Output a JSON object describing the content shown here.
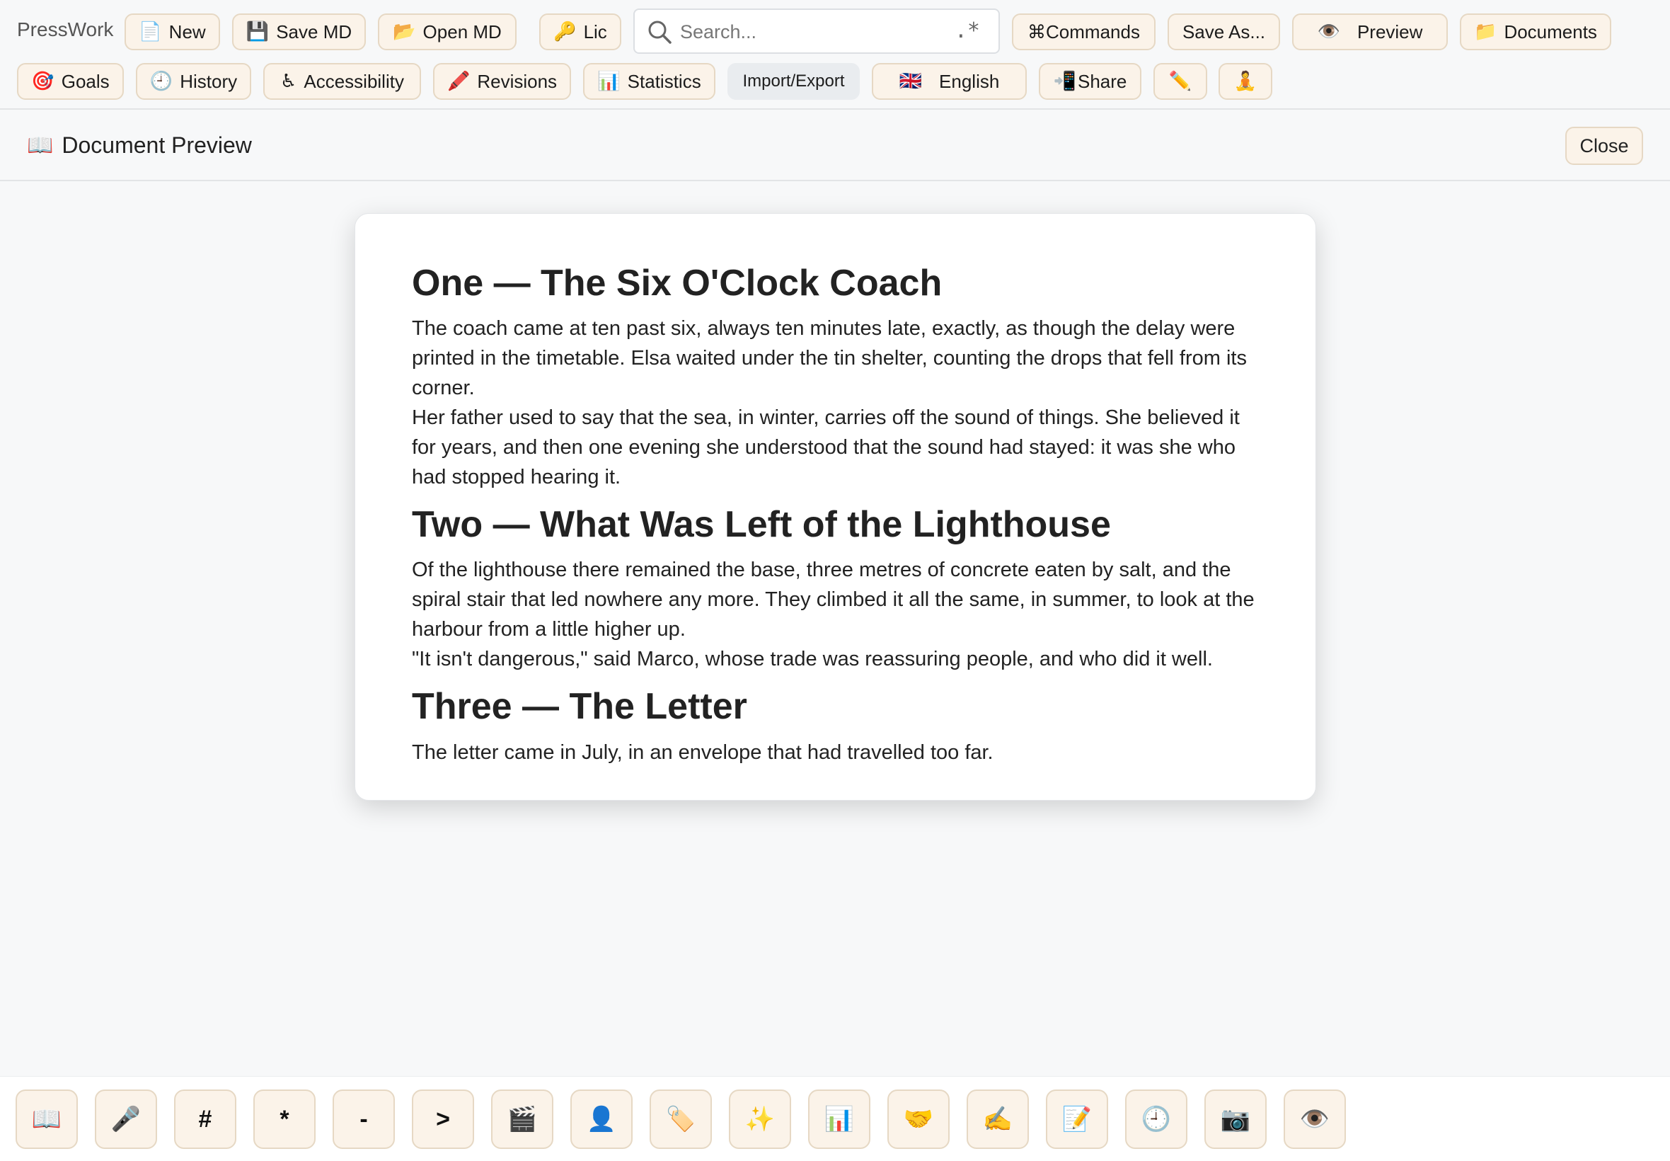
{
  "app": {
    "name": "PressWork"
  },
  "toolbar": {
    "row1": [
      {
        "id": "new",
        "icon": "📄",
        "icon_name": "page-icon",
        "label": "New"
      },
      {
        "id": "save-md",
        "icon": "💾",
        "icon_name": "floppy-disk-icon",
        "label": "Save MD"
      },
      {
        "id": "open-md",
        "icon": "📂",
        "icon_name": "open-folder-icon",
        "label": "Open MD"
      },
      {
        "id": "lic",
        "icon": "🔑",
        "icon_name": "key-icon",
        "label": "Lic"
      },
      {
        "id": "commands",
        "icon": "",
        "icon_name": "",
        "label": "⌘Commands"
      },
      {
        "id": "save-as",
        "icon": "",
        "icon_name": "",
        "label": "Save As..."
      },
      {
        "id": "preview",
        "icon": "👁️",
        "icon_name": "eye-icon",
        "label": "Preview"
      },
      {
        "id": "documents",
        "icon": "📁",
        "icon_name": "folder-icon",
        "label": "Documents"
      }
    ],
    "row2": [
      {
        "id": "goals",
        "icon": "🎯",
        "icon_name": "target-icon",
        "label": "Goals"
      },
      {
        "id": "history",
        "icon": "🕘",
        "icon_name": "clock-icon",
        "label": "History"
      },
      {
        "id": "accessibility",
        "icon": "♿",
        "icon_name": "wheelchair-icon",
        "label": "Accessibility"
      },
      {
        "id": "revisions",
        "icon": "🖍️",
        "icon_name": "crayon-icon",
        "label": "Revisions"
      },
      {
        "id": "statistics",
        "icon": "📊",
        "icon_name": "bar-chart-icon",
        "label": "Statistics"
      },
      {
        "id": "import-export",
        "icon": "",
        "icon_name": "",
        "label": "Import/Export"
      },
      {
        "id": "language",
        "icon": "🇬🇧",
        "icon_name": "uk-flag-icon",
        "label": "English"
      },
      {
        "id": "share",
        "icon": "📲",
        "icon_name": "phone-arrow-icon",
        "label": "Share"
      },
      {
        "id": "pencil",
        "icon": "✏️",
        "icon_name": "pencil-icon",
        "label": ""
      },
      {
        "id": "focus",
        "icon": "🧘",
        "icon_name": "meditation-icon",
        "label": ""
      }
    ],
    "search": {
      "placeholder": "Search...",
      "regex_label": ".*"
    }
  },
  "preview": {
    "title_icon": "📖",
    "title": "Document Preview",
    "close_label": "Close"
  },
  "document": {
    "sections": [
      {
        "heading": "One — The Six O'Clock Coach",
        "paragraphs": [
          "The coach came at ten past six, always ten minutes late, exactly, as though the delay were printed in the timetable. Elsa waited under the tin shelter, counting the drops that fell from its corner.",
          "Her father used to say that the sea, in winter, carries off the sound of things. She believed it for years, and then one evening she understood that the sound had stayed: it was she who had stopped hearing it."
        ]
      },
      {
        "heading": "Two — What Was Left of the Lighthouse",
        "paragraphs": [
          "Of the lighthouse there remained the base, three metres of concrete eaten by salt, and the spiral stair that led nowhere any more. They climbed it all the same, in summer, to look at the harbour from a little higher up.",
          "\"It isn't dangerous,\" said Marco, whose trade was reassuring people, and who did it well."
        ]
      },
      {
        "heading": "Three — The Letter",
        "paragraphs": [
          "The letter came in July, in an envelope that had travelled too far."
        ]
      }
    ]
  },
  "bottom_bar": [
    {
      "glyph": "📖",
      "name": "book-icon"
    },
    {
      "glyph": "🎤",
      "name": "microphone-icon"
    },
    {
      "glyph": "#",
      "name": "heading-button"
    },
    {
      "glyph": "*",
      "name": "emphasis-button"
    },
    {
      "glyph": "-",
      "name": "list-button"
    },
    {
      "glyph": ">",
      "name": "quote-button"
    },
    {
      "glyph": "🎬",
      "name": "clapperboard-icon"
    },
    {
      "glyph": "👤",
      "name": "person-icon"
    },
    {
      "glyph": "🏷️",
      "name": "tag-icon"
    },
    {
      "glyph": "✨",
      "name": "sparkles-icon"
    },
    {
      "glyph": "📊",
      "name": "bar-chart-icon"
    },
    {
      "glyph": "🤝",
      "name": "handshake-icon"
    },
    {
      "glyph": "✍️",
      "name": "writing-hand-icon"
    },
    {
      "glyph": "📝",
      "name": "memo-icon"
    },
    {
      "glyph": "🕘",
      "name": "clock-icon"
    },
    {
      "glyph": "📷",
      "name": "camera-icon"
    },
    {
      "glyph": "👁️",
      "name": "eye-icon"
    }
  ]
}
